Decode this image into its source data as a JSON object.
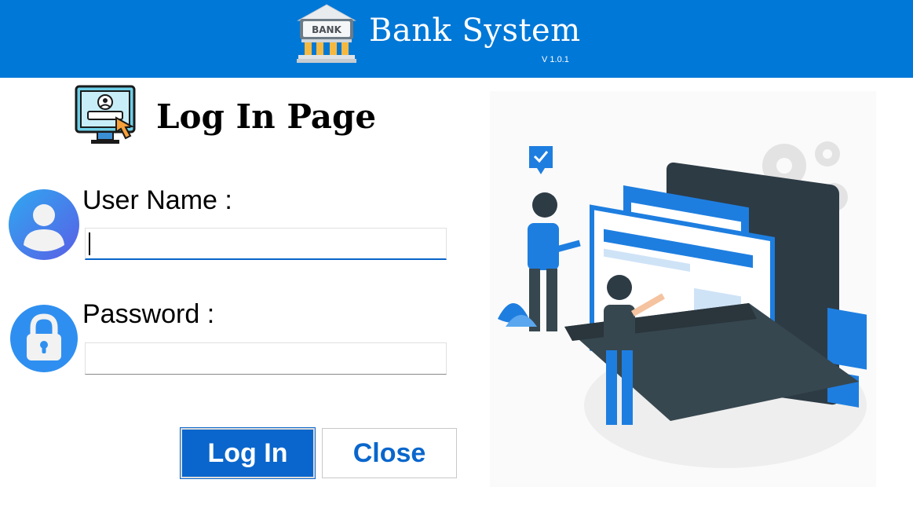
{
  "header": {
    "title": "Bank System",
    "version": "V 1.0.1",
    "logo_text": "BANK",
    "logo_icon": "bank-building-icon",
    "background_color": "#0078d7"
  },
  "page": {
    "title": "Log In Page",
    "icon": "computer-login-icon"
  },
  "form": {
    "username": {
      "label": "User Name :",
      "value": "",
      "placeholder": "",
      "icon": "user-avatar-icon"
    },
    "password": {
      "label": "Password :",
      "value": "",
      "placeholder": "",
      "icon": "padlock-icon"
    }
  },
  "buttons": {
    "login_label": "Log In",
    "close_label": "Close",
    "accent_color": "#0a66cc"
  },
  "illustration": {
    "description_icon": "people-with-laptop-illustration"
  }
}
